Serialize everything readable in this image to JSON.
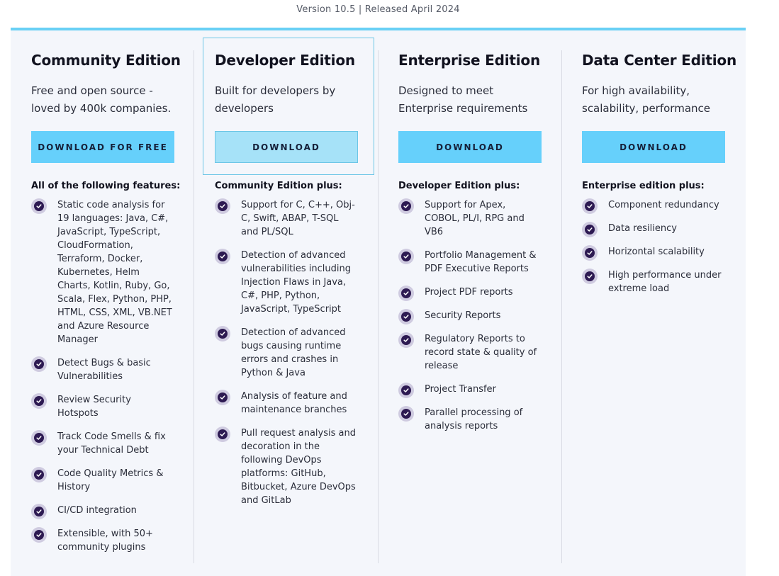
{
  "version_line": "Version 10.5 | Released April 2024",
  "colors": {
    "accent": "#69d0f5",
    "button": "#66d0fb",
    "check": "#2d1a52"
  },
  "editions": [
    {
      "title": "Community Edition",
      "desc_lines": [
        "Free and open source -",
        "loved by 400k companies."
      ],
      "button": "DOWNLOAD FOR FREE",
      "features_heading": "All of the following features:",
      "features": [
        [
          "Static code analysis for",
          "19 languages: Java, C#,",
          "JavaScript, TypeScript,",
          "CloudFormation,",
          "Terraform, Docker,",
          "Kubernetes, Helm",
          "Charts, Kotlin, Ruby, Go,",
          "Scala, Flex, Python, PHP,",
          "HTML, CSS, XML, VB.NET",
          "and Azure Resource",
          "Manager"
        ],
        [
          "Detect Bugs & basic",
          "Vulnerabilities"
        ],
        [
          "Review Security",
          "Hotspots"
        ],
        [
          "Track Code Smells & fix",
          "your Technical Debt"
        ],
        [
          "Code Quality Metrics &",
          "History"
        ],
        [
          "CI/CD integration"
        ],
        [
          "Extensible, with 50+",
          "community plugins"
        ]
      ]
    },
    {
      "title": "Developer Edition",
      "desc_lines": [
        "Built for developers by",
        "developers"
      ],
      "button": "DOWNLOAD",
      "features_heading": "Community Edition plus:",
      "features": [
        [
          "Support for C, C++, Obj-",
          "C, Swift, ABAP, T-SQL",
          "and PL/SQL"
        ],
        [
          "Detection of advanced",
          "vulnerabilities including",
          "Injection Flaws in Java,",
          "C#, PHP, Python,",
          "JavaScript, TypeScript"
        ],
        [
          "Detection of advanced",
          "bugs causing runtime",
          "errors and crashes in",
          "Python & Java"
        ],
        [
          "Analysis of feature and",
          "maintenance branches"
        ],
        [
          "Pull request analysis and",
          "decoration in the",
          "following DevOps",
          "platforms: GitHub,",
          "Bitbucket, Azure DevOps",
          "and GitLab"
        ]
      ]
    },
    {
      "title": "Enterprise Edition",
      "desc_lines": [
        "Designed to meet",
        "Enterprise requirements"
      ],
      "button": "DOWNLOAD",
      "features_heading": "Developer Edition plus:",
      "features": [
        [
          "Support for Apex,",
          "COBOL, PL/I, RPG and",
          "VB6"
        ],
        [
          "Portfolio Management &",
          "PDF Executive Reports"
        ],
        [
          "Project PDF reports"
        ],
        [
          "Security Reports"
        ],
        [
          "Regulatory Reports to",
          "record state & quality of",
          "release"
        ],
        [
          "Project Transfer"
        ],
        [
          "Parallel processing of",
          "analysis reports"
        ]
      ]
    },
    {
      "title": "Data Center Edition",
      "desc_lines": [
        "For high availability,",
        "scalability, performance"
      ],
      "button": "DOWNLOAD",
      "features_heading": "Enterprise edition plus:",
      "features": [
        [
          "Component redundancy"
        ],
        [
          "Data resiliency"
        ],
        [
          "Horizontal scalability"
        ],
        [
          "High performance under",
          "extreme load"
        ]
      ]
    }
  ]
}
